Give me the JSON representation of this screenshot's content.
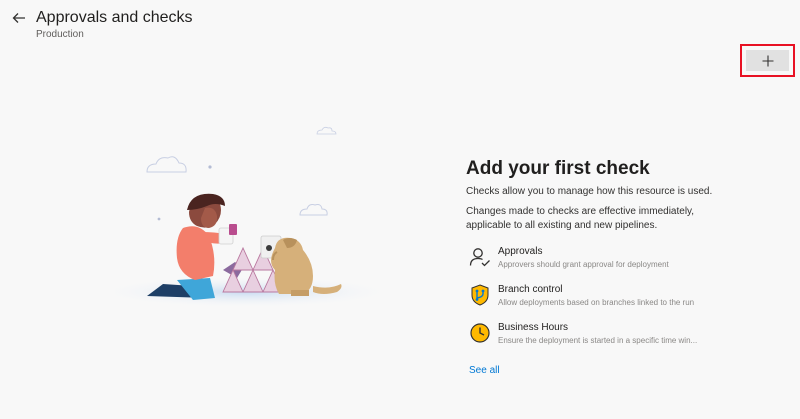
{
  "header": {
    "title": "Approvals and checks",
    "subtitle": "Production"
  },
  "icons": {
    "back": "back-arrow-icon",
    "add": "plus-icon"
  },
  "empty_state": {
    "title": "Add your first check",
    "description_1": "Checks allow you to manage how this resource is used.",
    "description_2": "Changes made to checks are effective immediately, applicable to all existing and new pipelines.",
    "checks": [
      {
        "name": "Approvals",
        "description": "Approvers should grant approval for deployment",
        "icon": "approver-person-icon"
      },
      {
        "name": "Branch control",
        "description": "Allow deployments based on branches linked to the run",
        "icon": "branch-shield-icon"
      },
      {
        "name": "Business Hours",
        "description": "Ensure the deployment is started in a specific time win...",
        "icon": "clock-icon"
      }
    ],
    "see_all_label": "See all"
  },
  "colors": {
    "accent": "#0078d4",
    "highlight_border": "#e81123",
    "background": "#f8f8f8"
  }
}
